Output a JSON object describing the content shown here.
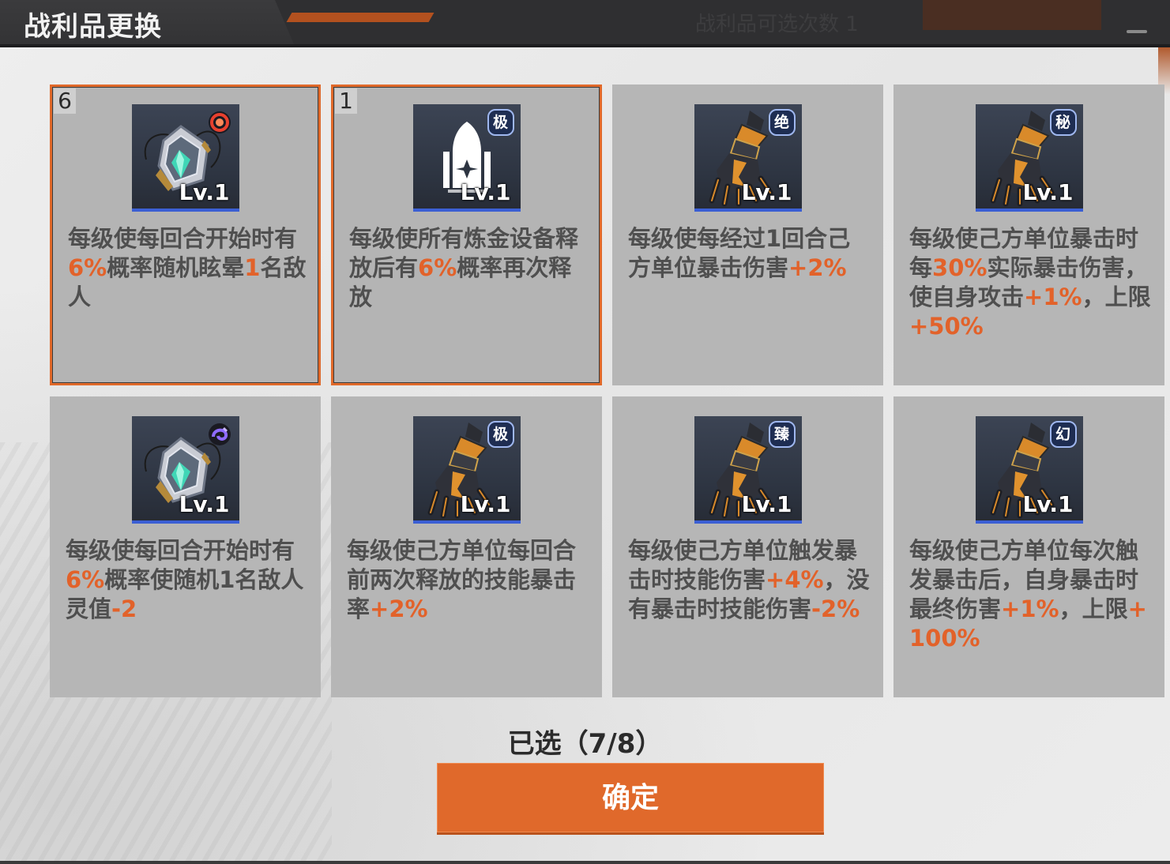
{
  "window": {
    "title": "战利品更换",
    "header_faded_text": "战利品可选次数 1"
  },
  "cards": [
    {
      "count": "6",
      "selected": true,
      "badge": "",
      "badge_icon": "red-swirl-icon",
      "item": "amulet",
      "level": "Lv.1",
      "desc": [
        {
          "t": "每级使每回合开始时有"
        },
        {
          "t": "6%",
          "h": true
        },
        {
          "t": "概率随机眩晕"
        },
        {
          "t": "1",
          "h": true
        },
        {
          "t": "名敌人"
        }
      ]
    },
    {
      "count": "1",
      "selected": true,
      "badge": "极",
      "item": "device",
      "level": "Lv.1",
      "desc": [
        {
          "t": "每级使所有炼金设备释放后有"
        },
        {
          "t": "6%",
          "h": true
        },
        {
          "t": "概率再次释放"
        }
      ]
    },
    {
      "count": "",
      "selected": false,
      "badge": "绝",
      "item": "gauntlet",
      "level": "Lv.1",
      "desc": [
        {
          "t": "每级使每经过1回合己方单位暴击伤害"
        },
        {
          "t": "+2%",
          "h": true
        }
      ]
    },
    {
      "count": "",
      "selected": false,
      "badge": "秘",
      "item": "gauntlet",
      "level": "Lv.1",
      "desc": [
        {
          "t": "每级使己方单位暴击时每"
        },
        {
          "t": "30%",
          "h": true
        },
        {
          "t": "实际暴击伤害，使自身攻击"
        },
        {
          "t": "+1%",
          "h": true
        },
        {
          "t": "，上限"
        },
        {
          "t": "+50%",
          "h": true
        }
      ]
    },
    {
      "count": "",
      "selected": false,
      "badge": "",
      "badge_icon": "purple-swirl-icon",
      "item": "amulet",
      "level": "Lv.1",
      "desc": [
        {
          "t": "每级使每回合开始时有"
        },
        {
          "t": "6%",
          "h": true
        },
        {
          "t": "概率使随机1名敌人灵值"
        },
        {
          "t": "-2",
          "h": true
        }
      ]
    },
    {
      "count": "",
      "selected": false,
      "badge": "极",
      "item": "gauntlet",
      "level": "Lv.1",
      "desc": [
        {
          "t": "每级使己方单位每回合前两次释放的技能暴击率"
        },
        {
          "t": "+2%",
          "h": true
        }
      ]
    },
    {
      "count": "",
      "selected": false,
      "badge": "臻",
      "item": "gauntlet",
      "level": "Lv.1",
      "desc": [
        {
          "t": "每级使己方单位触发暴击时技能伤害"
        },
        {
          "t": "+4%",
          "h": true
        },
        {
          "t": "，没有暴击时技能伤害"
        },
        {
          "t": "-2%",
          "h": true
        }
      ]
    },
    {
      "count": "",
      "selected": false,
      "badge": "幻",
      "item": "gauntlet",
      "level": "Lv.1",
      "desc": [
        {
          "t": "每级使己方单位每次触发暴击后，自身暴击时最终伤害"
        },
        {
          "t": "+1%",
          "h": true
        },
        {
          "t": "，上限"
        },
        {
          "t": "+100%",
          "h": true
        }
      ]
    }
  ],
  "footer": {
    "selected_text": "已选（7/8）",
    "confirm_label": "确定"
  },
  "colors": {
    "accent": "#e0692b",
    "highlight": "#e2622a",
    "card_bg": "#b6b6b6",
    "badge_border": "#9fb7ef"
  }
}
